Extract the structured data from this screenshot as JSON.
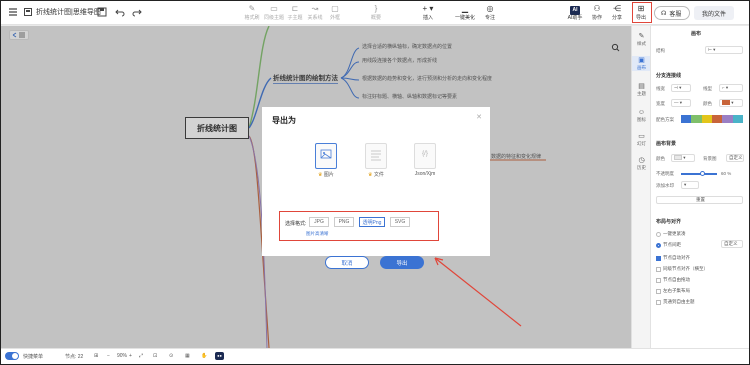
{
  "app": {
    "doc_title": "折线统计图|思维导图"
  },
  "toolbar": {
    "tools": [
      {
        "label": "格式刷"
      },
      {
        "label": "同级主题"
      },
      {
        "label": "子主题"
      },
      {
        "label": "关系线"
      },
      {
        "label": "外框"
      },
      {
        "label": "概要"
      },
      {
        "label": "插入"
      },
      {
        "label": "一键美化"
      },
      {
        "label": "专注"
      }
    ],
    "ai_label": "AI助手",
    "collab_label": "协作",
    "share_label": "分享",
    "export_label": "导出",
    "client_label": "客服",
    "my_files_label": "我的文件"
  },
  "mindmap": {
    "root": "折线统计图",
    "subtopic": "折线统计图的绘制方法",
    "children": [
      "选择合适的横纵轴标，确定数据点的位置",
      "用线段连接各个数据点，形成折线",
      "根据数据的趋势和变化，进行预测和分析的走向和变化程度",
      "标注好标题、横轴、纵轴和数据标记等要素"
    ],
    "branch_right": "数据的特征和变化规律"
  },
  "export_dialog": {
    "title": "导出为",
    "options": [
      {
        "label": "图片",
        "selected": true
      },
      {
        "label": "文件",
        "selected": false
      },
      {
        "label": "Json/Xjm",
        "selected": false
      }
    ],
    "format_label": "选择格式:",
    "formats": [
      {
        "label": "JPG",
        "selected": false
      },
      {
        "label": "PNG",
        "selected": false
      },
      {
        "label": "透明Png",
        "selected": true
      },
      {
        "label": "SVG",
        "selected": false
      }
    ],
    "link_text": "图片高清晰",
    "cancel_label": "取消",
    "export_label": "导出"
  },
  "right_strip": [
    {
      "label": "样式"
    },
    {
      "label": "画布"
    },
    {
      "label": "主题"
    },
    {
      "label": "图标"
    },
    {
      "label": "幻灯"
    },
    {
      "label": "历史"
    }
  ],
  "panel": {
    "header": "画布",
    "structure_label": "结构",
    "branch_section": "分支连接线",
    "branch_width_label": "线宽",
    "branch_style_label": "线型",
    "color_label": "宽度",
    "color2_label": "颜色",
    "scheme_label": "配色方案",
    "canvas_bg_section": "画布背景",
    "bg_color_label": "颜色",
    "bg_image_label": "背景图",
    "custom_label": "自定义",
    "opacity_label": "不透明度",
    "opacity_value": "60 %",
    "watermark_label": "添加水印",
    "reset_label": "重置",
    "layout_section": "布局与对齐",
    "layout_options": [
      {
        "label": "一键更紧凑",
        "on": false
      },
      {
        "label": "节点间距",
        "on": true
      }
    ],
    "custom2_label": "自定义",
    "checks": [
      {
        "label": "节点自动对齐",
        "on": true
      },
      {
        "label": "同级节点对齐（横至）",
        "on": false
      },
      {
        "label": "节点自由拖动",
        "on": false
      },
      {
        "label": "左右子集布局",
        "on": false
      },
      {
        "label": "贯通到自由主题",
        "on": false
      }
    ],
    "colors": {
      "bg_swatch": "#3b73d3",
      "accent": "#c8643a"
    }
  },
  "bottom": {
    "mode_label": "快捷菜单",
    "nodes_label": "节点: 22",
    "zoom": "90%"
  },
  "colors": {
    "primary": "#3b73d3",
    "annotation_red": "#e0463a"
  }
}
